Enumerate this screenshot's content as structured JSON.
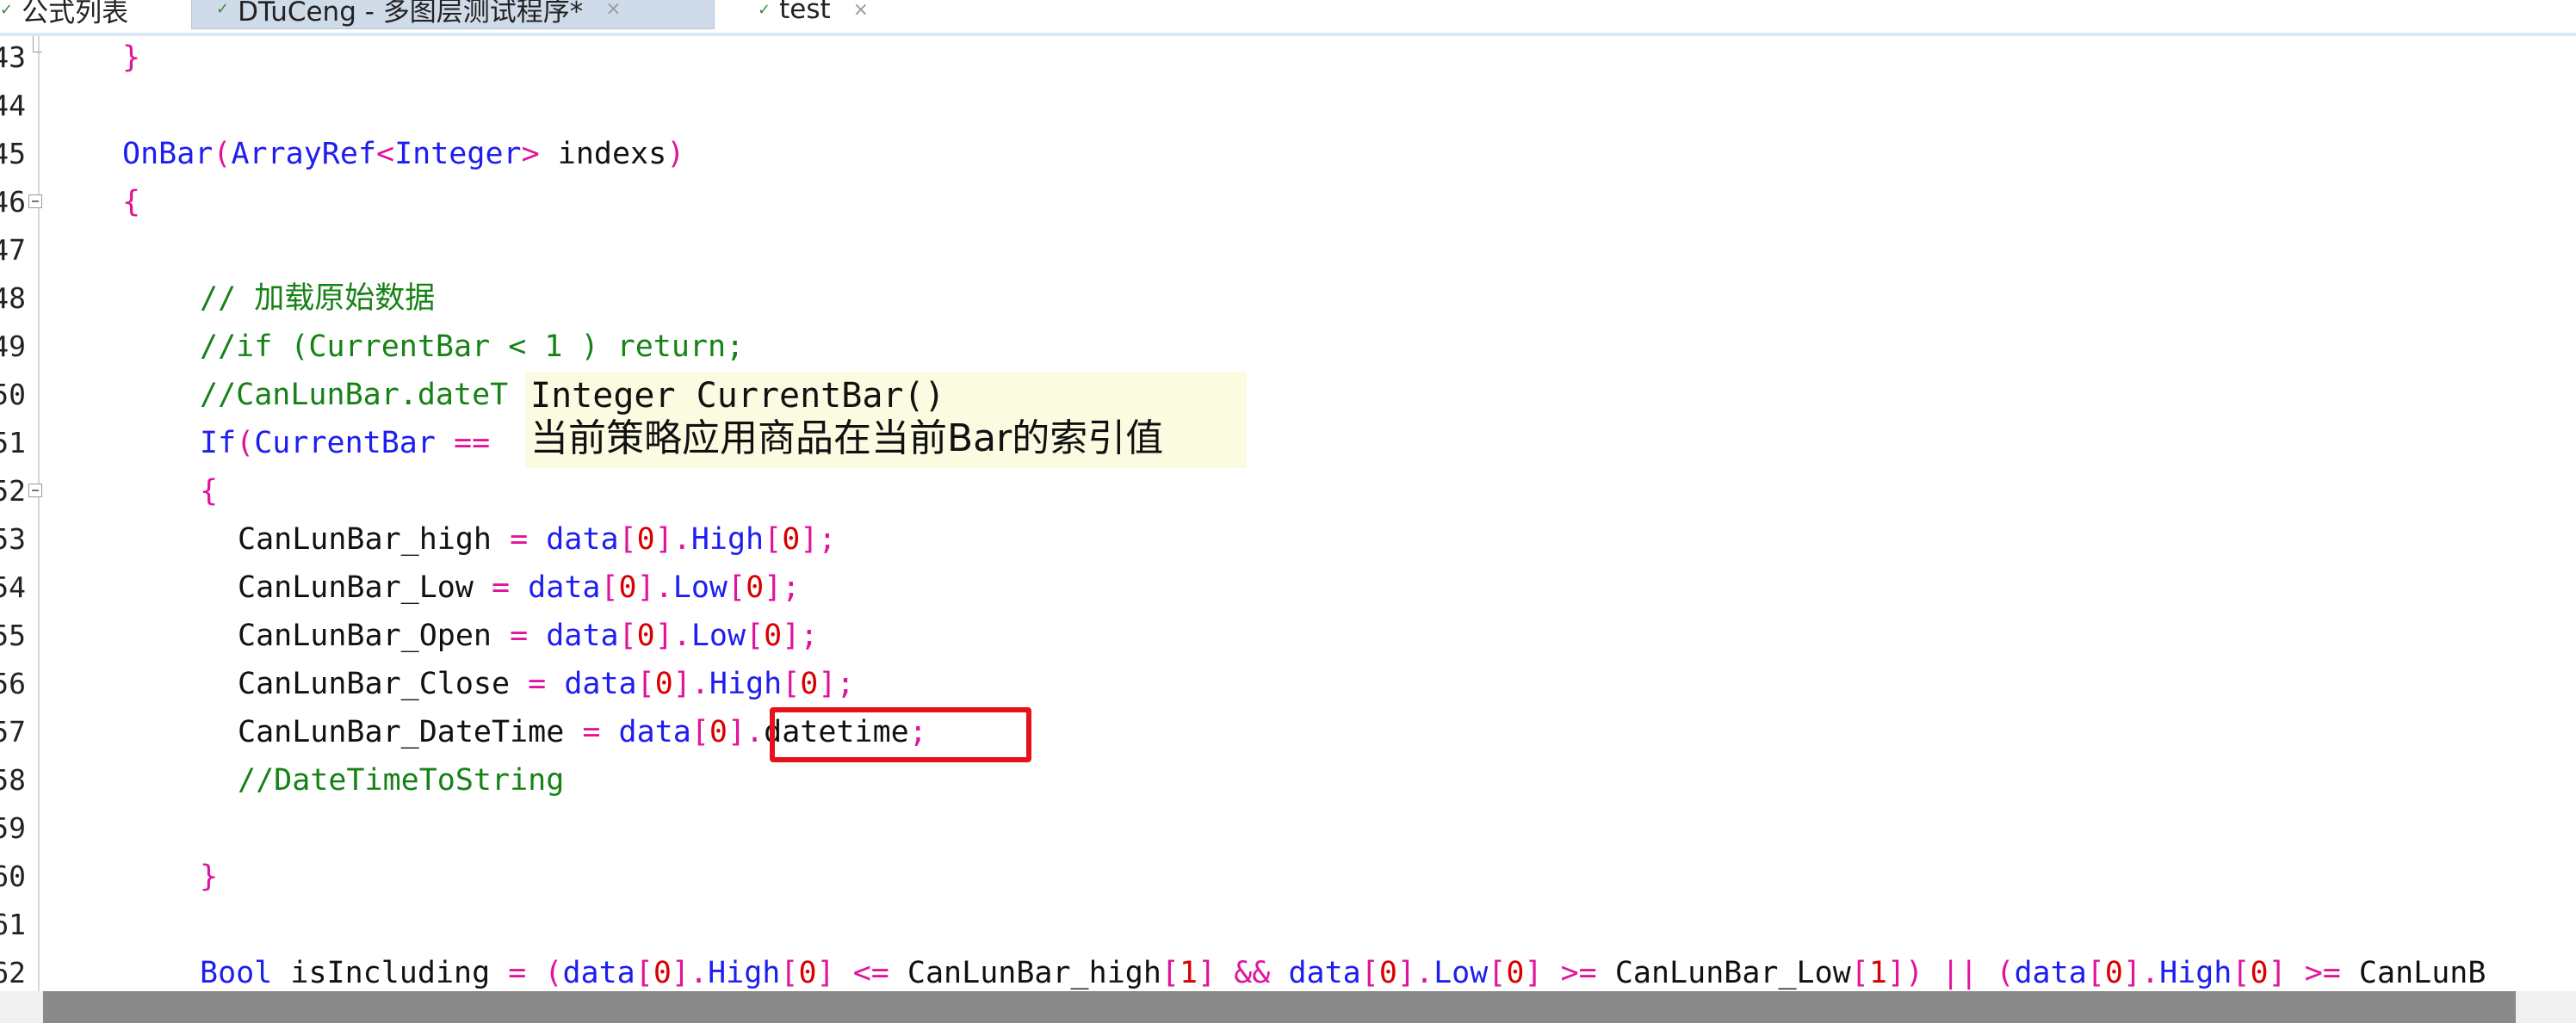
{
  "tabs": [
    {
      "label": "公式列表",
      "icon": "formula-list-icon",
      "active": false,
      "closable": false
    },
    {
      "label": "DTuCeng - 多图层测试程序*",
      "icon": "modified-file-icon",
      "active": true,
      "closable": true
    },
    {
      "label": "test",
      "icon": "modified-file-icon",
      "active": false,
      "closable": true
    }
  ],
  "tab_close_glyph": "×",
  "tab_mark_glyph": "✓",
  "gutter": {
    "line_numbers": [
      "43",
      "44",
      "45",
      "46",
      "47",
      "48",
      "49",
      "50",
      "51",
      "52",
      "53",
      "54",
      "55",
      "56",
      "57",
      "58",
      "59",
      "60",
      "61",
      "62"
    ]
  },
  "code_lines": [
    [
      [
        "op",
        "}"
      ]
    ],
    [],
    [
      [
        "kw",
        "OnBar"
      ],
      [
        "op",
        "("
      ],
      [
        "kw",
        "ArrayRef"
      ],
      [
        "op",
        "<"
      ],
      [
        "kw",
        "Integer"
      ],
      [
        "op",
        ">"
      ],
      [
        "plain",
        " indexs"
      ],
      [
        "op",
        ")"
      ]
    ],
    [
      [
        "op",
        "{"
      ]
    ],
    [],
    [
      [
        "cm",
        "// 加载原始数据"
      ]
    ],
    [
      [
        "cm",
        "//if (CurrentBar < 1 ) return;"
      ]
    ],
    [
      [
        "cm",
        "//CanLunBar.dateT"
      ]
    ],
    [
      [
        "kw",
        "If"
      ],
      [
        "op",
        "("
      ],
      [
        "kw",
        "CurrentBar"
      ],
      [
        "plain",
        " "
      ],
      [
        "op",
        "=="
      ]
    ],
    [
      [
        "op",
        "{"
      ]
    ],
    [
      [
        "plain",
        "CanLunBar_high "
      ],
      [
        "op",
        "="
      ],
      [
        "plain",
        " "
      ],
      [
        "kw",
        "data"
      ],
      [
        "op",
        "["
      ],
      [
        "num",
        "0"
      ],
      [
        "op",
        "]."
      ],
      [
        "kw",
        "High"
      ],
      [
        "op",
        "["
      ],
      [
        "num",
        "0"
      ],
      [
        "op",
        "];"
      ]
    ],
    [
      [
        "plain",
        "CanLunBar_Low "
      ],
      [
        "op",
        "="
      ],
      [
        "plain",
        " "
      ],
      [
        "kw",
        "data"
      ],
      [
        "op",
        "["
      ],
      [
        "num",
        "0"
      ],
      [
        "op",
        "]."
      ],
      [
        "kw",
        "Low"
      ],
      [
        "op",
        "["
      ],
      [
        "num",
        "0"
      ],
      [
        "op",
        "];"
      ]
    ],
    [
      [
        "plain",
        "CanLunBar_Open "
      ],
      [
        "op",
        "="
      ],
      [
        "plain",
        " "
      ],
      [
        "kw",
        "data"
      ],
      [
        "op",
        "["
      ],
      [
        "num",
        "0"
      ],
      [
        "op",
        "]."
      ],
      [
        "kw",
        "Low"
      ],
      [
        "op",
        "["
      ],
      [
        "num",
        "0"
      ],
      [
        "op",
        "];"
      ]
    ],
    [
      [
        "plain",
        "CanLunBar_Close "
      ],
      [
        "op",
        "="
      ],
      [
        "plain",
        " "
      ],
      [
        "kw",
        "data"
      ],
      [
        "op",
        "["
      ],
      [
        "num",
        "0"
      ],
      [
        "op",
        "]."
      ],
      [
        "kw",
        "High"
      ],
      [
        "op",
        "["
      ],
      [
        "num",
        "0"
      ],
      [
        "op",
        "];"
      ]
    ],
    [
      [
        "plain",
        "CanLunBar_DateTime "
      ],
      [
        "op",
        "="
      ],
      [
        "plain",
        " "
      ],
      [
        "kw",
        "data"
      ],
      [
        "op",
        "["
      ],
      [
        "num",
        "0"
      ],
      [
        "op",
        "]."
      ],
      [
        "plain",
        "datetime"
      ],
      [
        "op",
        ";"
      ]
    ],
    [
      [
        "cm",
        "//DateTimeToString"
      ]
    ],
    [],
    [
      [
        "op",
        "}"
      ]
    ],
    [],
    [
      [
        "kw",
        "Bool"
      ],
      [
        "plain",
        " isIncluding "
      ],
      [
        "op",
        "="
      ],
      [
        "plain",
        " "
      ],
      [
        "op",
        "("
      ],
      [
        "kw",
        "data"
      ],
      [
        "op",
        "["
      ],
      [
        "num",
        "0"
      ],
      [
        "op",
        "]."
      ],
      [
        "kw",
        "High"
      ],
      [
        "op",
        "["
      ],
      [
        "num",
        "0"
      ],
      [
        "op",
        "]"
      ],
      [
        "plain",
        " "
      ],
      [
        "op",
        "<="
      ],
      [
        "plain",
        " CanLunBar_high"
      ],
      [
        "op",
        "["
      ],
      [
        "num",
        "1"
      ],
      [
        "op",
        "]"
      ],
      [
        "plain",
        " "
      ],
      [
        "op",
        "&&"
      ],
      [
        "plain",
        " "
      ],
      [
        "kw",
        "data"
      ],
      [
        "op",
        "["
      ],
      [
        "num",
        "0"
      ],
      [
        "op",
        "]."
      ],
      [
        "kw",
        "Low"
      ],
      [
        "op",
        "["
      ],
      [
        "num",
        "0"
      ],
      [
        "op",
        "]"
      ],
      [
        "plain",
        " "
      ],
      [
        "op",
        ">="
      ],
      [
        "plain",
        " CanLunBar_Low"
      ],
      [
        "op",
        "["
      ],
      [
        "num",
        "1"
      ],
      [
        "op",
        "])"
      ],
      [
        "plain",
        " "
      ],
      [
        "op",
        "||"
      ],
      [
        "plain",
        " "
      ],
      [
        "op",
        "("
      ],
      [
        "kw",
        "data"
      ],
      [
        "op",
        "["
      ],
      [
        "num",
        "0"
      ],
      [
        "op",
        "]."
      ],
      [
        "kw",
        "High"
      ],
      [
        "op",
        "["
      ],
      [
        "num",
        "0"
      ],
      [
        "op",
        "]"
      ],
      [
        "plain",
        " "
      ],
      [
        "op",
        ">="
      ],
      [
        "plain",
        " CanLunB"
      ]
    ]
  ],
  "tooltip": {
    "signature": "Integer CurrentBar()",
    "description": "当前策略应用商品在当前Bar的索引值"
  },
  "colors": {
    "keyword": "#1e1ef0",
    "operator": "#e0139d",
    "number": "#d80000",
    "comment": "#168216",
    "highlight": "#e8101a",
    "tooltip_bg": "#fbfbe2"
  }
}
